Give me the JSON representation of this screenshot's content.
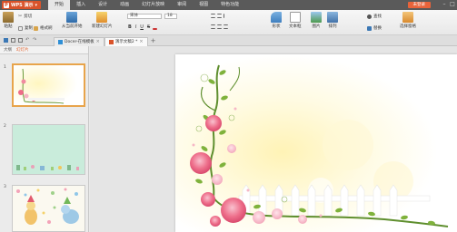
{
  "app": {
    "name": "WPS 演示",
    "login_label": "未登录"
  },
  "menu": {
    "tabs": [
      "开始",
      "插入",
      "设计",
      "动画",
      "幻灯片放映",
      "审阅",
      "视图",
      "特色功能"
    ],
    "active": "开始"
  },
  "ribbon": {
    "paste": "粘贴",
    "cut": "剪切",
    "copy": "复制",
    "format_painter": "格式刷",
    "from_current": "从当前开始",
    "new_slide": "新建幻灯片",
    "font_name": "宋体",
    "font_size": "18",
    "format_buttons": [
      "B",
      "I",
      "U",
      "S"
    ],
    "shape": "形状",
    "textbox": "文本框",
    "picture": "图片",
    "arrange": "排列",
    "find": "查找",
    "replace": "替换",
    "select_pane": "选择窗格"
  },
  "tabbar": {
    "docs": [
      {
        "title": "Docer-在线模板",
        "active": false
      },
      {
        "title": "演示文稿2 *",
        "active": true
      }
    ]
  },
  "left_panel": {
    "tabs": [
      "大纲",
      "幻灯片"
    ],
    "active_tab": "幻灯片",
    "slides": [
      {
        "number": "1",
        "selected": true
      },
      {
        "number": "2",
        "selected": false
      },
      {
        "number": "3",
        "selected": false
      }
    ]
  },
  "colors": {
    "titlebar": "#5a5a5a",
    "wps_orange": "#d9532a",
    "accent_orange": "#e0602b",
    "selected_border": "#e8a44b"
  }
}
